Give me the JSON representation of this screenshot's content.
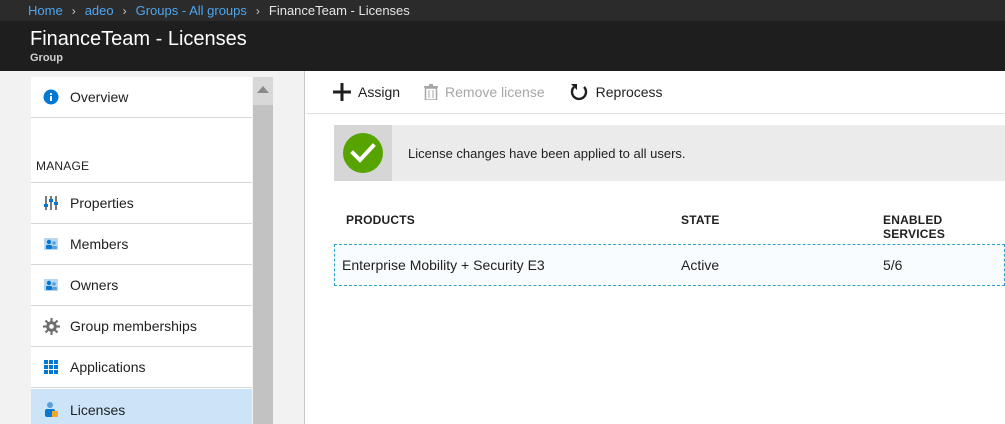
{
  "breadcrumb": {
    "items": [
      "Home",
      "adeo",
      "Groups - All groups"
    ],
    "current": "FinanceTeam - Licenses"
  },
  "header": {
    "title": "FinanceTeam - Licenses",
    "subtitle": "Group"
  },
  "sidebar": {
    "overview": "Overview",
    "section_label": "MANAGE",
    "items": [
      "Properties",
      "Members",
      "Owners",
      "Group memberships",
      "Applications",
      "Licenses"
    ],
    "active": "Licenses"
  },
  "toolbar": {
    "assign": "Assign",
    "remove_license": "Remove license",
    "reprocess": "Reprocess"
  },
  "notification": {
    "message": "License changes have been applied to all users.",
    "status": "success"
  },
  "table": {
    "columns": [
      "PRODUCTS",
      "STATE",
      "ENABLED SERVICES"
    ],
    "rows": [
      [
        "Enterprise Mobility + Security E3",
        "Active",
        "5/6"
      ]
    ]
  },
  "colors": {
    "accent": "#0078d4",
    "link": "#4ea6f0",
    "success": "#57a300",
    "header_bg": "#1e1e1e",
    "active_nav": "#cce4f7"
  },
  "icons": {
    "overview": "info-icon",
    "properties": "sliders-icon",
    "members": "users-icon",
    "owners": "users-icon",
    "group_memberships": "gear-icon",
    "applications": "grid-icon",
    "licenses": "license-user-icon",
    "assign": "plus-icon",
    "remove": "trash-icon",
    "reprocess": "refresh-icon",
    "notice": "checkmark-icon"
  }
}
